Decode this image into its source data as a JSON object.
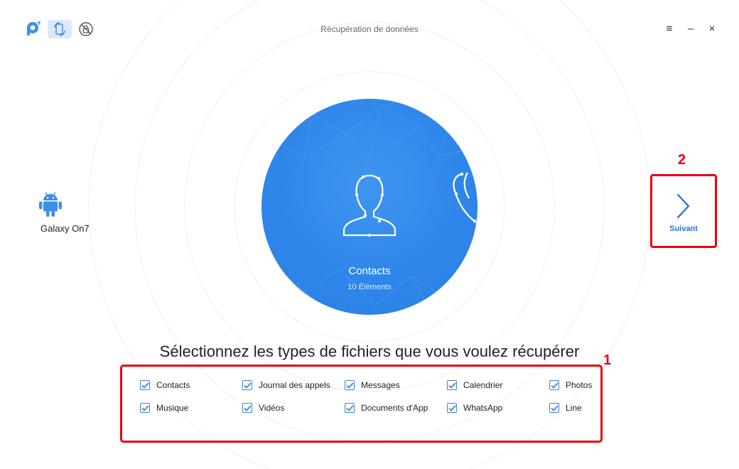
{
  "window": {
    "title": "Récupération de données",
    "controls": {
      "menu": "≡",
      "minimize": "–",
      "close": "×"
    }
  },
  "toolbar": {
    "icons": [
      "phonerescue-logo-icon",
      "data-recovery-icon",
      "lock-removal-icon"
    ]
  },
  "device": {
    "name": "Galaxy On7",
    "icon": "android-icon"
  },
  "carousel": {
    "current_title": "Contacts",
    "current_count": "10 Éléments",
    "icon": "contact-person-icon"
  },
  "next": {
    "label": "Suivant",
    "icon": "chevron-right-icon"
  },
  "annotations": {
    "options": "1",
    "next": "2"
  },
  "heading": "Sélectionnez les types de fichiers que vous voulez récupérer",
  "file_types": [
    {
      "label": "Contacts",
      "checked": true
    },
    {
      "label": "Journal des appels",
      "checked": true
    },
    {
      "label": "Messages",
      "checked": true
    },
    {
      "label": "Calendrier",
      "checked": true
    },
    {
      "label": "Photos",
      "checked": true
    },
    {
      "label": "Musique",
      "checked": true
    },
    {
      "label": "Vidéos",
      "checked": true
    },
    {
      "label": "Documents d'App",
      "checked": true
    },
    {
      "label": "WhatsApp",
      "checked": true
    },
    {
      "label": "Line",
      "checked": true
    }
  ],
  "colors": {
    "accent": "#2f86ea",
    "annotation": "#e8000d",
    "link": "#2a6fd6"
  }
}
